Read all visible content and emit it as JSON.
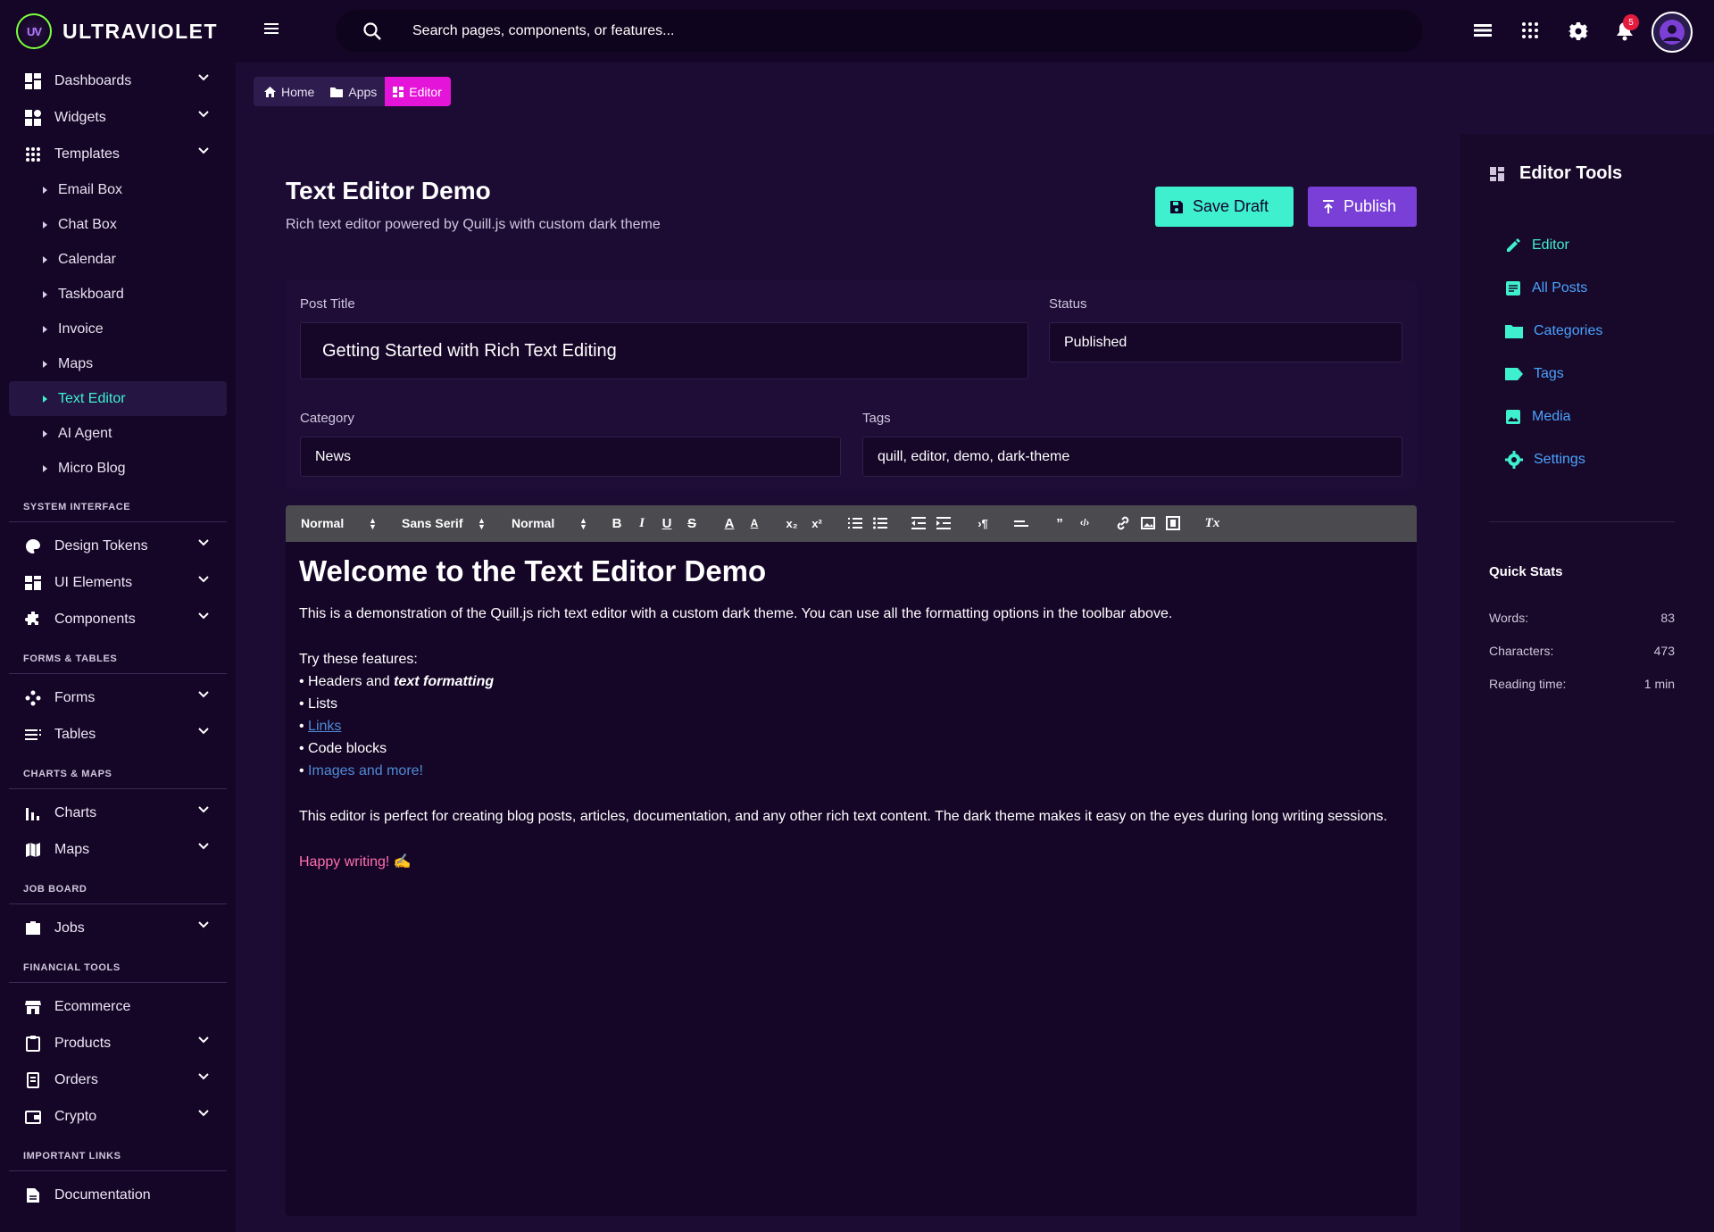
{
  "brand": {
    "name": "ULTRAVIOLET",
    "logo_text": "UV"
  },
  "sidebar": {
    "top_items": [
      {
        "label": "Dashboards",
        "icon": "dashboard-icon"
      },
      {
        "label": "Widgets",
        "icon": "widgets-icon"
      },
      {
        "label": "Templates",
        "icon": "templates-icon"
      }
    ],
    "template_items": [
      "Email Box",
      "Chat Box",
      "Calendar",
      "Taskboard",
      "Invoice",
      "Maps",
      "Text Editor",
      "AI Agent",
      "Micro Blog"
    ],
    "active_template": "Text Editor",
    "sections": {
      "system_interface": {
        "title": "SYSTEM INTERFACE",
        "items": [
          "Design Tokens",
          "UI Elements",
          "Components"
        ]
      },
      "forms_tables": {
        "title": "FORMS & TABLES",
        "items": [
          "Forms",
          "Tables"
        ]
      },
      "charts_maps": {
        "title": "CHARTS & MAPS",
        "items": [
          "Charts",
          "Maps"
        ]
      },
      "job_board": {
        "title": "JOB BOARD",
        "items": [
          "Jobs"
        ]
      },
      "financial_tools": {
        "title": "FINANCIAL TOOLS",
        "items": [
          "Ecommerce",
          "Products",
          "Orders",
          "Crypto"
        ]
      },
      "important_links": {
        "title": "IMPORTANT LINKS",
        "items": [
          "Documentation"
        ]
      }
    }
  },
  "topbar": {
    "search_placeholder": "Search pages, components, or features...",
    "notification_count": "5"
  },
  "breadcrumb": {
    "home": "Home",
    "apps": "Apps",
    "current": "Editor"
  },
  "page": {
    "title": "Text Editor Demo",
    "subtitle": "Rich text editor powered by Quill.js with custom dark theme",
    "save_draft_label": "Save Draft",
    "publish_label": "Publish"
  },
  "form": {
    "post_title_label": "Post Title",
    "post_title_value": "Getting Started with Rich Text Editing",
    "status_label": "Status",
    "status_value": "Published",
    "category_label": "Category",
    "category_value": "News",
    "tags_label": "Tags",
    "tags_value": "quill, editor, demo, dark-theme"
  },
  "toolbar": {
    "header_select": "Normal",
    "font_select": "Sans Serif",
    "size_select": "Normal"
  },
  "editor": {
    "heading": "Welcome to the Text Editor Demo",
    "intro": "This is a demonstration of the Quill.js rich text editor with a custom dark theme. You can use all the formatting options in the toolbar above.",
    "features_title": "Try these features:",
    "bullet": "• ",
    "feature_headers": "Headers and ",
    "feature_headers_em": "text formatting",
    "feature_lists": "Lists",
    "feature_links": "Links",
    "feature_code": "Code blocks",
    "feature_images": "Images and more!",
    "outro": "This editor is perfect for creating blog posts, articles, documentation, and any other rich text content. The dark theme makes it easy on the eyes during long writing sessions.",
    "signoff": "Happy writing! ✍"
  },
  "right_panel": {
    "title": "Editor Tools",
    "items": [
      "Editor",
      "All Posts",
      "Categories",
      "Tags",
      "Media",
      "Settings"
    ],
    "quick_stats_title": "Quick Stats",
    "stats": [
      {
        "label": "Words:",
        "value": "83"
      },
      {
        "label": "Characters:",
        "value": "473"
      },
      {
        "label": "Reading time:",
        "value": "1 min"
      }
    ]
  },
  "colors": {
    "accent_teal": "#3ff0cf",
    "accent_magenta": "#e414d8",
    "accent_purple": "#7a3fd6",
    "link_blue": "#4aa3ff"
  }
}
